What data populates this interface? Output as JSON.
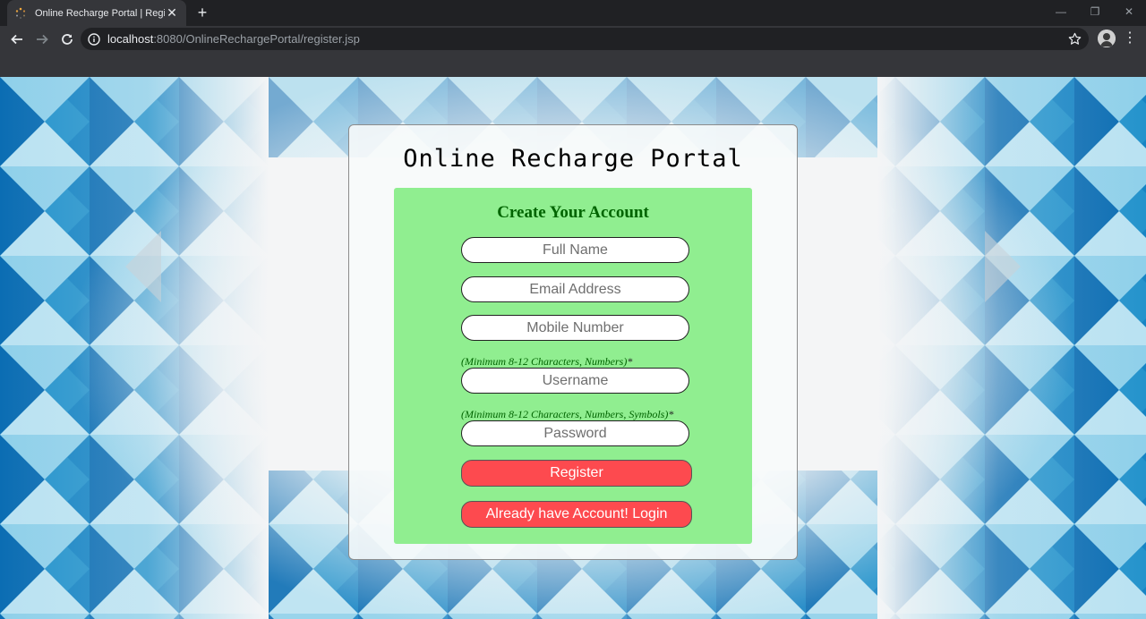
{
  "browser": {
    "tab_title": "Online Recharge Portal | Register",
    "url_host": "localhost",
    "url_rest": ":8080/OnlineRechargePortal/register.jsp"
  },
  "page": {
    "portal_title": "Online Recharge Portal",
    "form_heading": "Create Your Account",
    "fields": {
      "full_name": {
        "placeholder": "Full Name"
      },
      "email": {
        "placeholder": "Email Address"
      },
      "mobile": {
        "placeholder": "Mobile Number"
      },
      "username": {
        "placeholder": "Username",
        "hint": "(Minimum 8-12 Characters, Numbers)",
        "hint_marker": "*"
      },
      "password": {
        "placeholder": "Password",
        "hint": "(Minimum 8-12 Characters, Numbers, Symbols)",
        "hint_marker": "*"
      }
    },
    "register_label": "Register",
    "login_label": "Already have Account! Login"
  },
  "colors": {
    "form_bg": "#90ee90",
    "heading": "#006400",
    "button": "#fd4a4f",
    "pattern_dark": "#0a6fb6",
    "pattern_light": "#7cc7e6"
  }
}
